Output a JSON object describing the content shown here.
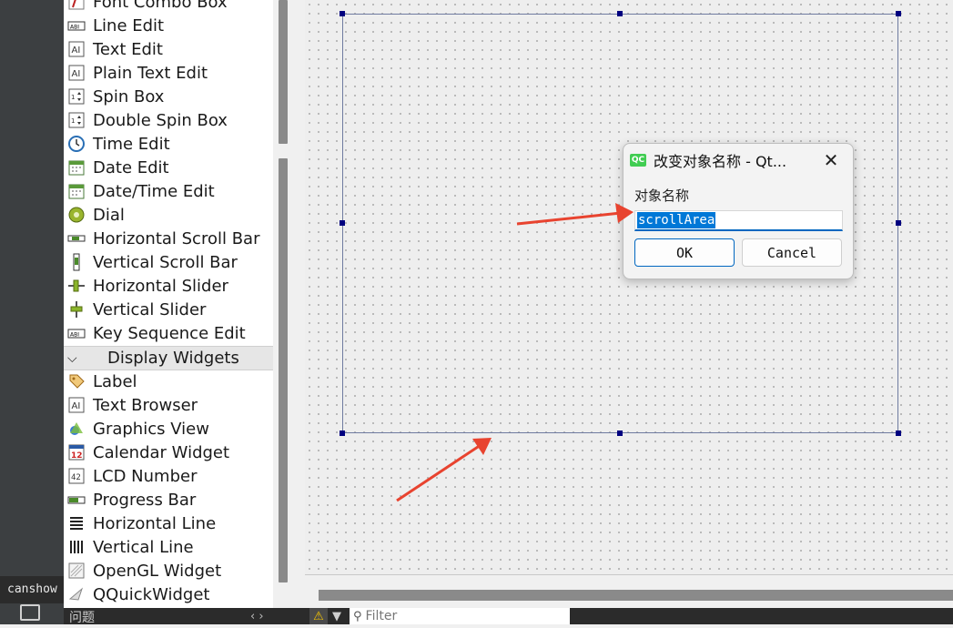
{
  "widget_box": {
    "items_top": [
      {
        "label": "Font Combo Box",
        "icon": "font-combo-icon"
      },
      {
        "label": "Line Edit",
        "icon": "line-edit-icon"
      },
      {
        "label": "Text Edit",
        "icon": "text-edit-icon"
      },
      {
        "label": "Plain Text Edit",
        "icon": "plain-text-edit-icon"
      },
      {
        "label": "Spin Box",
        "icon": "spin-box-icon"
      },
      {
        "label": "Double Spin Box",
        "icon": "double-spin-box-icon"
      },
      {
        "label": "Time Edit",
        "icon": "clock-icon"
      },
      {
        "label": "Date Edit",
        "icon": "calendar-icon"
      },
      {
        "label": "Date/Time Edit",
        "icon": "datetime-icon"
      },
      {
        "label": "Dial",
        "icon": "dial-icon"
      },
      {
        "label": "Horizontal Scroll Bar",
        "icon": "hscrollbar-icon"
      },
      {
        "label": "Vertical Scroll Bar",
        "icon": "vscrollbar-icon"
      },
      {
        "label": "Horizontal Slider",
        "icon": "hslider-icon"
      },
      {
        "label": "Vertical Slider",
        "icon": "vslider-icon"
      },
      {
        "label": "Key Sequence Edit",
        "icon": "key-sequence-icon"
      }
    ],
    "category_label": "Display Widgets",
    "items_display": [
      {
        "label": "Label",
        "icon": "label-tag-icon"
      },
      {
        "label": "Text Browser",
        "icon": "text-browser-icon"
      },
      {
        "label": "Graphics View",
        "icon": "graphics-view-icon"
      },
      {
        "label": "Calendar Widget",
        "icon": "calendar-widget-icon"
      },
      {
        "label": "LCD Number",
        "icon": "lcd-number-icon"
      },
      {
        "label": "Progress Bar",
        "icon": "progress-bar-icon"
      },
      {
        "label": "Horizontal Line",
        "icon": "horizontal-line-icon"
      },
      {
        "label": "Vertical Line",
        "icon": "vertical-line-icon"
      },
      {
        "label": "OpenGL Widget",
        "icon": "opengl-widget-icon"
      },
      {
        "label": "QQuickWidget",
        "icon": "qquickwidget-icon"
      }
    ]
  },
  "left_strip": {
    "canshow": "canshow"
  },
  "dialog": {
    "title": "改变对象名称 - Qt...",
    "logo_text": "QC",
    "field_label": "对象名称",
    "input_value": "scrollArea",
    "ok_label": "OK",
    "cancel_label": "Cancel",
    "close_glyph": "✕"
  },
  "bottom_bar": {
    "issues_label": "问题",
    "filter_placeholder": "Filter"
  },
  "colors": {
    "selection_handle": "#000080",
    "arrow": "#e8432f",
    "accent": "#0067c0"
  }
}
